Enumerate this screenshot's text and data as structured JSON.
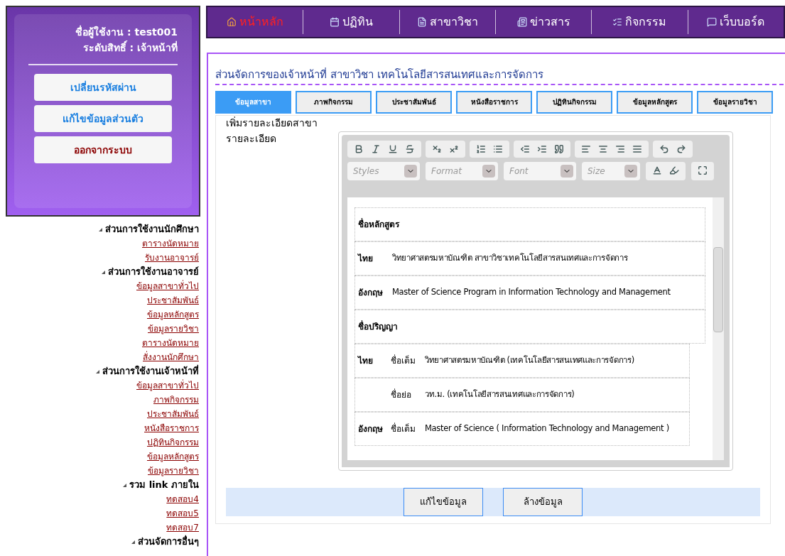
{
  "user_panel": {
    "username": "ชื่อผู้ใช้งาน : test001",
    "role": "ระดับสิทธิ์ : เจ้าหน้าที่",
    "buttons": [
      {
        "label": "เปลี่ยนรหัสผ่าน",
        "kind": "normal"
      },
      {
        "label": "แก้ไขข้อมูลส่วนตัว",
        "kind": "normal"
      },
      {
        "label": "ออกจากระบบ",
        "kind": "logout"
      }
    ]
  },
  "sidebar": [
    {
      "title": "ส่วนการใช้งานนักศึกษา",
      "links": [
        "ตารางนัดหมาย",
        "รับงานอาจารย์"
      ]
    },
    {
      "title": "ส่วนการใช้งานอาจารย์",
      "links": [
        "ข้อมูลสาขาทั่วไป",
        "ประชาสัมพันธ์",
        "ข้อมูลหลักสูตร",
        "ข้อมูลรายวิชา",
        "ตารางนัดหมาย",
        "สั่งงานนักศึกษา"
      ]
    },
    {
      "title": "ส่วนการใช้งานเจ้าหน้าที่",
      "links": [
        "ข้อมูลสาขาทั่วไป",
        "ภาพกิจกรรม",
        "ประชาสัมพันธ์",
        "หนังสือราชการ",
        "ปฏิทินกิจกรรม",
        "ข้อมูลหลักสูตร",
        "ข้อมูลรายวิชา"
      ]
    },
    {
      "title": "รวม link ภายใน",
      "links": [
        "ทดสอบ4",
        "ทดสอบ5",
        "ทดสอบ7"
      ]
    },
    {
      "title": "ส่วนจัดการอื่นๆ"
    }
  ],
  "nav": [
    {
      "label": "หน้าหลัก",
      "selected": true
    },
    {
      "label": "ปฏิทิน",
      "selected": false
    },
    {
      "label": "สาขาวิชา",
      "selected": false
    },
    {
      "label": "ข่าวสาร",
      "selected": false
    },
    {
      "label": "กิจกรรม",
      "selected": false
    },
    {
      "label": "เว็บบอร์ด",
      "selected": false
    }
  ],
  "page_title": "ส่วนจัดการของเจ้าหน้าที่ สาขาวิชา เทคโนโลยีสารสนเทศและการจัดการ",
  "tabs": [
    {
      "label": "ข้อมูลสาขา",
      "selected": true
    },
    {
      "label": "ภาพกิจกรรม",
      "selected": false
    },
    {
      "label": "ประชาสัมพันธ์",
      "selected": false
    },
    {
      "label": "หนังสือราชการ",
      "selected": false
    },
    {
      "label": "ปฏิทินกิจกรรม",
      "selected": false
    },
    {
      "label": "ข้อมูลหลักสูตร",
      "selected": false
    },
    {
      "label": "ข้อมูลรายวิชา",
      "selected": false
    }
  ],
  "form": {
    "heading": "เพิ่มรายละเอียดสาขา",
    "label": "รายละเอียด",
    "editor": {
      "combos": [
        {
          "placeholder": "Styles"
        },
        {
          "placeholder": "Format"
        },
        {
          "placeholder": "Font"
        },
        {
          "placeholder": "Size"
        }
      ],
      "content": [
        {
          "kind": "heading",
          "text": "ชื่อหลักสูตร"
        },
        {
          "kind": "row",
          "lang": "ไทย",
          "value": "วิทยาศาสตรมหาบัณฑิต สาขาวิชาเทคโนโลยีสารสนเทศและการจัดการ"
        },
        {
          "kind": "row",
          "lang": "อังกฤษ",
          "value": "Master of Science Program in Information Technology and Management"
        },
        {
          "kind": "heading",
          "text": "ชื่อปริญญา"
        },
        {
          "kind": "subrow",
          "lang": "ไทย",
          "field": "ชื่อเต็ม",
          "value": "วิทยาศาสตรมหาบัณฑิต (เทคโนโลยีสารสนเทศและการจัดการ)"
        },
        {
          "kind": "subrow",
          "field": "ชื่อย่อ",
          "value": "วท.ม. (เทคโนโลยีสารสนเทศและการจัดการ)"
        },
        {
          "kind": "subrow",
          "lang": "อังกฤษ",
          "field": "ชื่อเต็ม",
          "value": "Master of Science ( Information Technology and Management )"
        }
      ]
    },
    "buttons": [
      "แก้ไขข้อมูล",
      "ล้างข้อมูล"
    ]
  }
}
